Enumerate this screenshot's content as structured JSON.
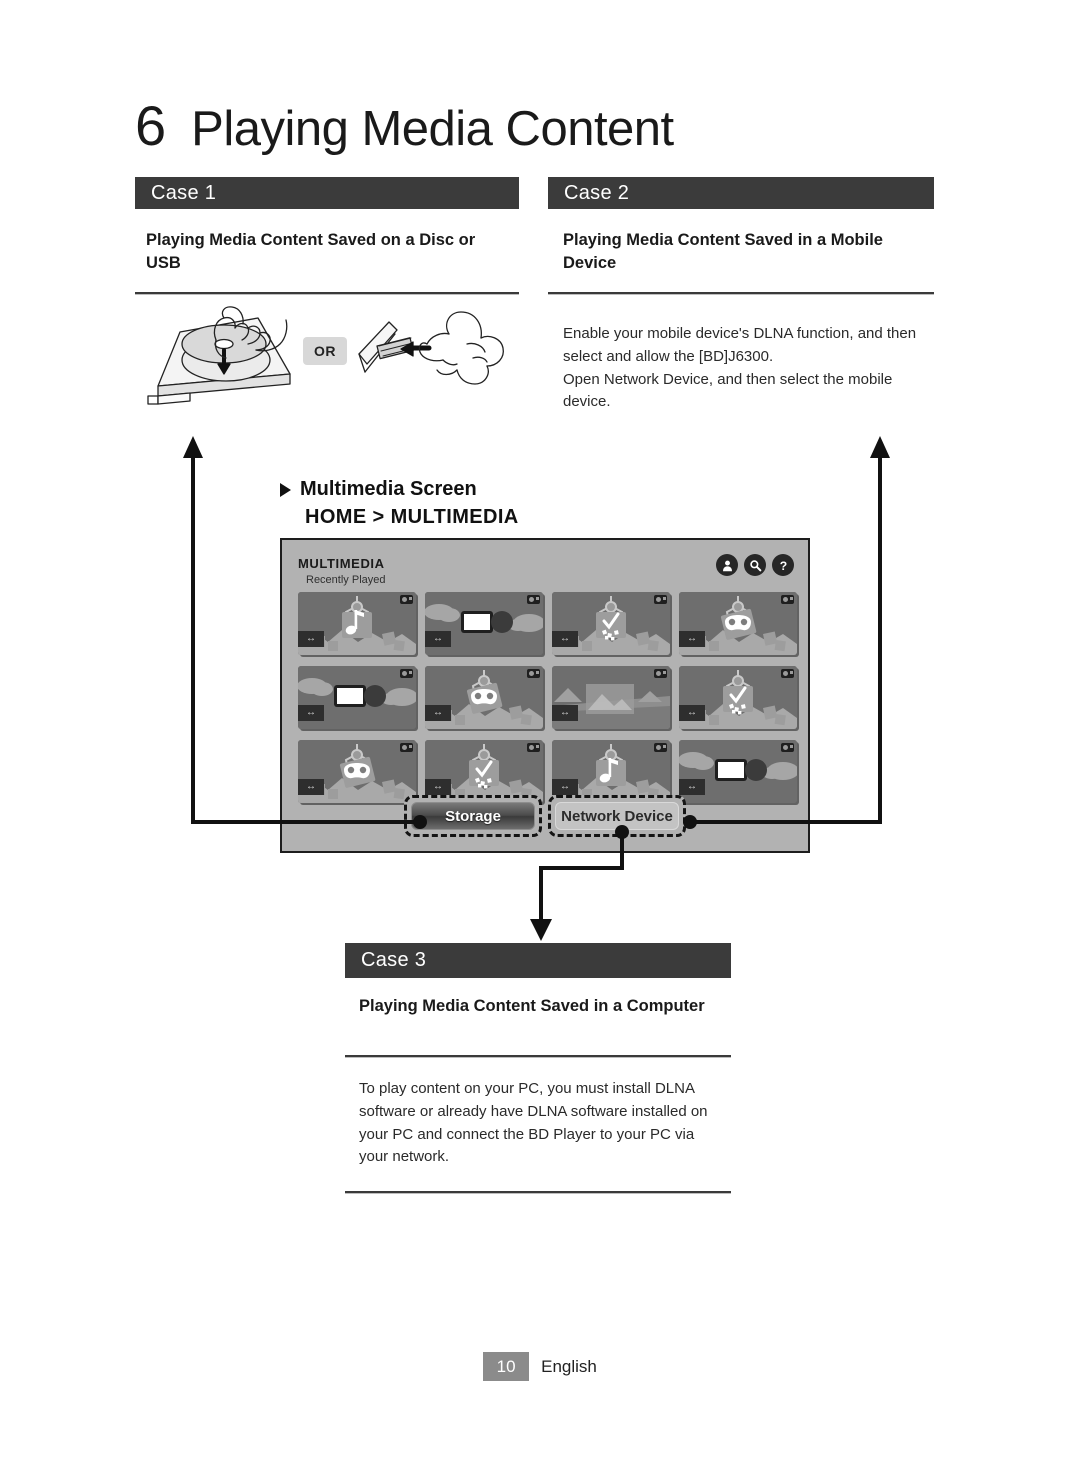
{
  "chapter": {
    "number": "6",
    "title": "Playing Media Content"
  },
  "cases": {
    "case1": {
      "label": "Case 1",
      "subtitle": "Playing Media Content Saved on a Disc or USB",
      "or_label": "OR",
      "illustration": "disc-tray-and-usb-insert-illustration"
    },
    "case2": {
      "label": "Case 2",
      "subtitle": "Playing Media Content Saved in a Mobile Device",
      "body": "Enable your mobile device's DLNA function, and then select and allow the [BD]J6300.\nOpen Network Device, and then select the mobile device."
    },
    "case3": {
      "label": "Case 3",
      "subtitle": "Playing Media Content Saved in a Computer",
      "body": "To play content on your PC, you must install DLNA software or already have DLNA software installed on your PC and connect the BD Player to your PC via your network."
    }
  },
  "multimedia_callout": {
    "line1": "Multimedia Screen",
    "line2": "HOME > MULTIMEDIA",
    "bullet_icon": "triangle-right-icon"
  },
  "tv_screen": {
    "title": "MULTIMEDIA",
    "subtitle": "Recently Played",
    "icons": [
      {
        "name": "account-icon",
        "glyph": "person"
      },
      {
        "name": "search-icon",
        "glyph": "magnifier"
      },
      {
        "name": "help-icon",
        "glyph": "question"
      }
    ],
    "grid": [
      {
        "kind": "music",
        "badge": "camera-badge"
      },
      {
        "kind": "video",
        "badge": "camera-badge"
      },
      {
        "kind": "clapper",
        "badge": "camera-badge"
      },
      {
        "kind": "game",
        "badge": "camera-badge"
      },
      {
        "kind": "video",
        "badge": "camera-badge"
      },
      {
        "kind": "game",
        "badge": "camera-badge"
      },
      {
        "kind": "photo",
        "badge": "camera-badge"
      },
      {
        "kind": "clapper",
        "badge": "camera-badge"
      },
      {
        "kind": "game",
        "badge": "camera-badge"
      },
      {
        "kind": "clapper",
        "badge": "camera-badge"
      },
      {
        "kind": "music",
        "badge": "camera-badge"
      },
      {
        "kind": "video",
        "badge": "camera-badge"
      }
    ],
    "tabs": [
      {
        "label": "Storage",
        "selected": true
      },
      {
        "label": "Network Device",
        "selected": false
      }
    ]
  },
  "colors": {
    "bar_dark": "#3b3b3b",
    "tv_background": "#b2b2b2",
    "thumb_background": "#6e6e6e",
    "page_badge": "#8b8b8b",
    "ink": "#1a1a1a"
  },
  "footer": {
    "page_number": "10",
    "language": "English"
  }
}
